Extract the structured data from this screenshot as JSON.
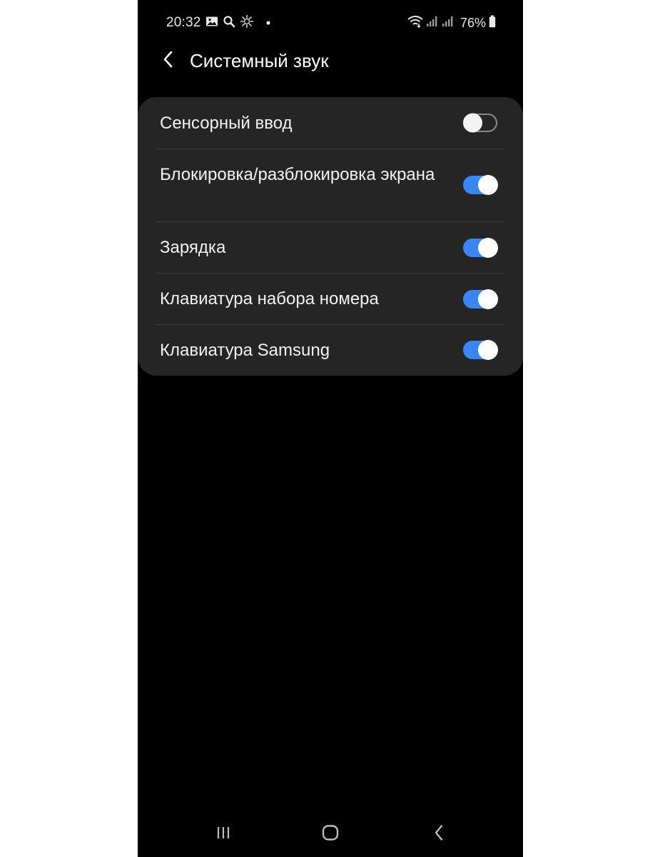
{
  "status_bar": {
    "time": "20:32",
    "left_icons": [
      "image-icon",
      "search-icon",
      "sync-icon",
      "dot-icon"
    ],
    "right_icons": [
      "wifi-icon",
      "signal-icon",
      "signal-icon",
      "battery-icon"
    ],
    "battery_percent": "76%"
  },
  "header": {
    "title": "Системный звук",
    "back_icon": "chevron-left-icon"
  },
  "settings": {
    "items": [
      {
        "label": "Сенсорный ввод",
        "enabled": false
      },
      {
        "label": "Блокировка/разблокировка экрана",
        "enabled": true
      },
      {
        "label": "Зарядка",
        "enabled": true
      },
      {
        "label": "Клавиатура набора номера",
        "enabled": true
      },
      {
        "label": "Клавиатура Samsung",
        "enabled": true
      }
    ]
  },
  "navbar": {
    "buttons": [
      "recent-apps-icon",
      "home-icon",
      "back-icon"
    ]
  },
  "colors": {
    "background": "#000000",
    "card": "#252525",
    "toggle_on": "#3c86f4",
    "divider": "#3c3c3c",
    "text": "#f2f2f2"
  }
}
